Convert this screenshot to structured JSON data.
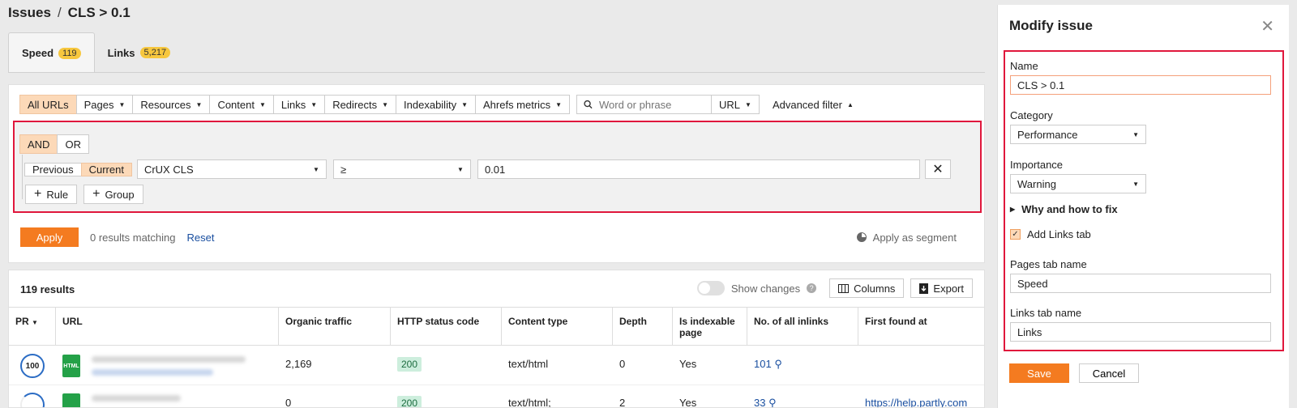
{
  "breadcrumb": {
    "root": "Issues",
    "separator": "/",
    "current": "CLS > 0.1"
  },
  "tabs": [
    {
      "label": "Speed",
      "badge": "119"
    },
    {
      "label": "Links",
      "badge": "5,217"
    }
  ],
  "filter_bar": {
    "segments": [
      "All URLs",
      "Pages",
      "Resources",
      "Content",
      "Links",
      "Redirects",
      "Indexability",
      "Ahrefs metrics"
    ],
    "search_placeholder": "Word or phrase",
    "search_scope": "URL",
    "advanced": "Advanced filter"
  },
  "rules": {
    "logic": [
      "AND",
      "OR"
    ],
    "period": [
      "Previous",
      "Current"
    ],
    "metric": "CrUX CLS",
    "operator": "≥",
    "value": "0.01",
    "add_rule": "Rule",
    "add_group": "Group"
  },
  "apply": {
    "button": "Apply",
    "matching": "0 results matching",
    "reset": "Reset",
    "segment": "Apply as segment"
  },
  "results": {
    "count": "119 results",
    "show_changes": "Show changes",
    "columns_btn": "Columns",
    "export_btn": "Export",
    "headers": [
      "PR",
      "URL",
      "Organic traffic",
      "HTTP status code",
      "Content type",
      "Depth",
      "Is indexable page",
      "No. of all inlinks",
      "First found at"
    ],
    "rows": [
      {
        "pr": "100",
        "file_icon": "HTML",
        "traffic": "2,169",
        "status": "200",
        "type": "text/html",
        "depth": "0",
        "indexable": "Yes",
        "inlinks": "101",
        "first_found": ""
      },
      {
        "pr": "",
        "file_icon": "",
        "traffic": "0",
        "status": "200",
        "type": "text/html;",
        "depth": "2",
        "indexable": "Yes",
        "inlinks": "33",
        "first_found": "https://help.partly.com"
      }
    ]
  },
  "modal": {
    "title": "Modify issue",
    "name_label": "Name",
    "name_value": "CLS > 0.1",
    "category_label": "Category",
    "category_value": "Performance",
    "importance_label": "Importance",
    "importance_value": "Warning",
    "why_label": "Why and how to fix",
    "links_tab_label": "Add Links tab",
    "pages_tab_label": "Pages tab name",
    "pages_tab_value": "Speed",
    "links_tab_name_label": "Links tab name",
    "links_tab_value": "Links",
    "save": "Save",
    "cancel": "Cancel"
  }
}
